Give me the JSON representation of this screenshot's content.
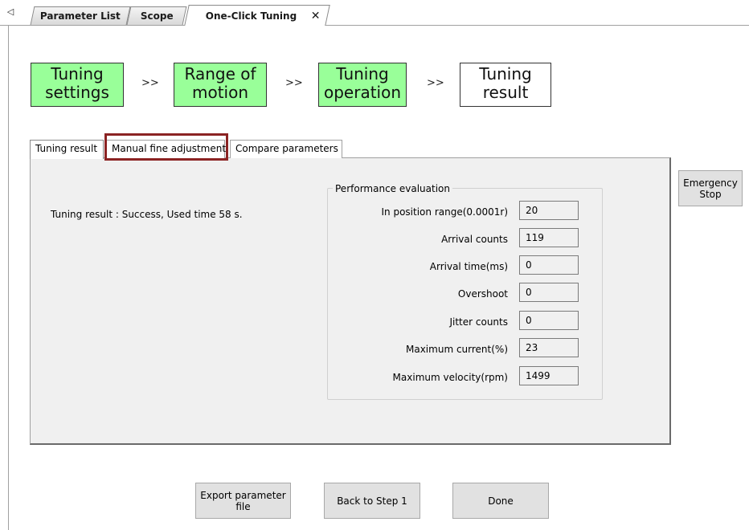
{
  "doc_tabs": {
    "scroll_left": "◁",
    "items": [
      {
        "label": "Parameter List"
      },
      {
        "label": "Scope"
      },
      {
        "label": "One-Click Tuning"
      }
    ],
    "close": "✕"
  },
  "steps": [
    {
      "label": "Tuning\nsettings",
      "state": "done"
    },
    {
      "label": "Range of\nmotion",
      "state": "done"
    },
    {
      "label": "Tuning\noperation",
      "state": "done"
    },
    {
      "label": "Tuning\nresult",
      "state": "current"
    }
  ],
  "step_separator": ">>",
  "inner_tabs": [
    {
      "label": "Tuning result"
    },
    {
      "label": "Manual fine adjustment"
    },
    {
      "label": "Compare parameters"
    }
  ],
  "result_text": "Tuning result : Success, Used time 58 s.",
  "performance": {
    "title": "Performance evaluation",
    "rows": [
      {
        "label": "In position range(0.0001r)",
        "value": "20"
      },
      {
        "label": "Arrival counts",
        "value": "119"
      },
      {
        "label": "Arrival time(ms)",
        "value": "0"
      },
      {
        "label": "Overshoot",
        "value": "0"
      },
      {
        "label": "Jitter counts",
        "value": "0"
      },
      {
        "label": "Maximum current(%)",
        "value": "23"
      },
      {
        "label": "Maximum velocity(rpm)",
        "value": "1499"
      }
    ]
  },
  "buttons": {
    "emergency_stop": "Emergency\nStop",
    "export": "Export parameter\nfile",
    "back": "Back to Step 1",
    "done": "Done"
  },
  "colors": {
    "step_done": "#99ff99",
    "highlight": "#8b2323"
  }
}
